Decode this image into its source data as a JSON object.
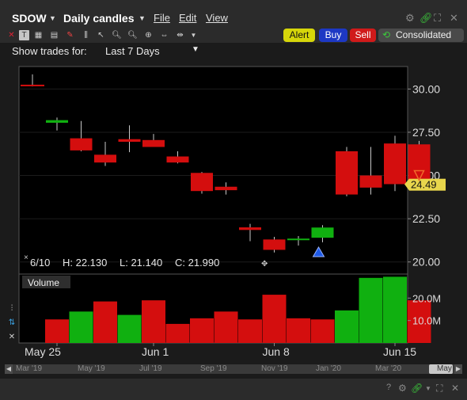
{
  "header": {
    "symbol": "SDOW",
    "chart_type": "Daily candles",
    "menus": [
      "File",
      "Edit",
      "View"
    ]
  },
  "toolbar": {
    "alert": "Alert",
    "buy": "Buy",
    "sell": "Sell",
    "consolidated": "Consolidated"
  },
  "trades": {
    "label": "Show trades for:",
    "value": "Last 7 Days"
  },
  "info_line": {
    "date": "6/10",
    "high": "H: 22.130",
    "low": "L: 21.140",
    "close": "C: 21.990"
  },
  "volume_label": "Volume",
  "price_tag": "24.49",
  "timeline": [
    "Mar '19",
    "May '19",
    "Jul '19",
    "Sep '19",
    "Nov '19",
    "Jan '20",
    "Mar '20",
    "May"
  ],
  "colors": {
    "up": "#10b010",
    "down": "#d40e0e",
    "background": "#000000",
    "price_tag": "#e8d64c",
    "alert": "#d6d60a",
    "buy": "#1d38c4",
    "sell": "#d01a1a"
  },
  "chart_data": [
    {
      "type": "candlestick",
      "x": [
        "May 22",
        "May 26",
        "May 27",
        "May 28",
        "May 29",
        "Jun 1",
        "Jun 2",
        "Jun 3",
        "Jun 4",
        "Jun 5",
        "Jun 8",
        "Jun 9",
        "Jun 10",
        "Jun 11",
        "Jun 12",
        "Jun 15",
        "Jun 16"
      ],
      "open": [
        30.25,
        28.05,
        27.15,
        26.2,
        27.1,
        27.05,
        26.1,
        25.15,
        24.35,
        22.0,
        21.3,
        21.3,
        21.4,
        26.4,
        25.0,
        26.85,
        26.8
      ],
      "high": [
        30.85,
        28.35,
        28.15,
        26.95,
        27.9,
        27.4,
        26.4,
        25.2,
        24.6,
        22.2,
        21.45,
        21.5,
        22.13,
        26.65,
        26.65,
        27.3,
        27.0
      ],
      "low": [
        30.15,
        27.6,
        26.4,
        25.55,
        26.35,
        26.65,
        25.7,
        23.95,
        23.9,
        21.2,
        20.55,
        20.95,
        21.14,
        23.8,
        23.9,
        24.1,
        24.3
      ],
      "close": [
        30.2,
        28.2,
        26.45,
        25.75,
        26.95,
        26.65,
        25.75,
        24.1,
        24.15,
        21.85,
        20.7,
        21.35,
        21.99,
        23.9,
        24.3,
        24.5,
        24.49
      ],
      "ylim": [
        19.3,
        31.3
      ],
      "yticks": [
        "30.00",
        "27.50",
        "25.00",
        "22.50",
        "20.00"
      ],
      "xlabels": [
        "May 25",
        "Jun 1",
        "Jun 8",
        "Jun 15"
      ]
    },
    {
      "type": "bar",
      "title": "Volume",
      "x": [
        "May 26",
        "May 27",
        "May 28",
        "May 29",
        "Jun 1",
        "Jun 2",
        "Jun 3",
        "Jun 4",
        "Jun 5",
        "Jun 8",
        "Jun 9",
        "Jun 10",
        "Jun 11",
        "Jun 12",
        "Jun 15",
        "Jun 16"
      ],
      "values": [
        10.5,
        14.0,
        18.5,
        12.5,
        19.0,
        8.5,
        11.0,
        14.0,
        10.5,
        21.5,
        11.0,
        10.5,
        14.5,
        29.0,
        29.5,
        19.0
      ],
      "up": [
        false,
        true,
        false,
        true,
        false,
        false,
        false,
        false,
        false,
        false,
        false,
        false,
        true,
        true,
        true,
        false
      ],
      "yticks": [
        "20.0M",
        "10.0M"
      ],
      "ylim": [
        0,
        30
      ]
    }
  ]
}
